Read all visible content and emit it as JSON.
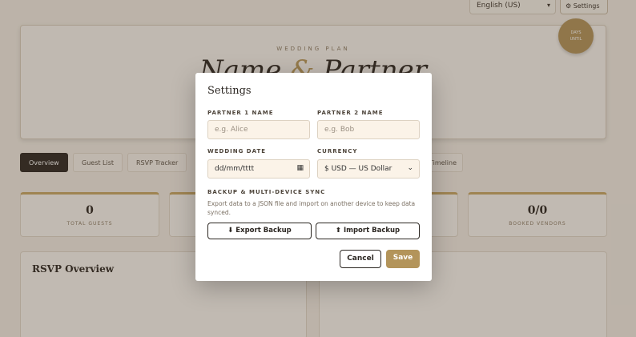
{
  "header": {
    "language": "English (US)",
    "settings_label": "Settings"
  },
  "hero": {
    "eyebrow": "WEDDING PLAN",
    "name1": "Name",
    "amp": "&",
    "name2": "Partner",
    "badge_line1": "DAYS",
    "badge_line2": "UNTIL"
  },
  "tabs": [
    {
      "label": "Overview"
    },
    {
      "label": "Guest List"
    },
    {
      "label": "RSVP Tracker"
    },
    {
      "label": "Timeline"
    }
  ],
  "stats": [
    {
      "value": "0",
      "label": "TOTAL GUESTS"
    },
    {
      "value": "0/0",
      "label": "BOOKED VENDORS"
    }
  ],
  "panels": {
    "rsvp_title": "RSVP Overview"
  },
  "modal": {
    "title": "Settings",
    "partner1": {
      "label": "PARTNER 1 NAME",
      "placeholder": "e.g. Alice"
    },
    "partner2": {
      "label": "PARTNER 2 NAME",
      "placeholder": "e.g. Bob"
    },
    "wedding_date": {
      "label": "WEDDING DATE",
      "placeholder": "dd/mm/tttt"
    },
    "currency": {
      "label": "CURRENCY",
      "value": "$ USD — US Dollar"
    },
    "backup": {
      "label": "BACKUP & MULTI-DEVICE SYNC",
      "description": "Export data to a JSON file and import on another device to keep data synced.",
      "export_label": "⬇ Export Backup",
      "import_label": "⬆ Import Backup"
    },
    "cancel_label": "Cancel",
    "save_label": "Save"
  },
  "colors": {
    "accent": "#b3945a",
    "dark": "#2b2621",
    "field_bg": "#fbf3e8"
  }
}
